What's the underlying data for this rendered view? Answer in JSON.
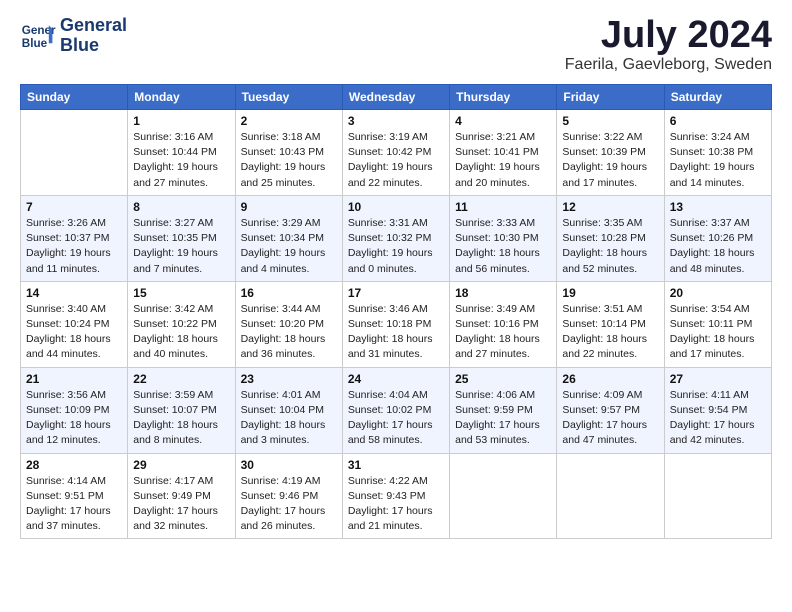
{
  "header": {
    "logo_line1": "General",
    "logo_line2": "Blue",
    "month": "July 2024",
    "location": "Faerila, Gaevleborg, Sweden"
  },
  "weekdays": [
    "Sunday",
    "Monday",
    "Tuesday",
    "Wednesday",
    "Thursday",
    "Friday",
    "Saturday"
  ],
  "weeks": [
    [
      {
        "day": "",
        "info": ""
      },
      {
        "day": "1",
        "info": "Sunrise: 3:16 AM\nSunset: 10:44 PM\nDaylight: 19 hours\nand 27 minutes."
      },
      {
        "day": "2",
        "info": "Sunrise: 3:18 AM\nSunset: 10:43 PM\nDaylight: 19 hours\nand 25 minutes."
      },
      {
        "day": "3",
        "info": "Sunrise: 3:19 AM\nSunset: 10:42 PM\nDaylight: 19 hours\nand 22 minutes."
      },
      {
        "day": "4",
        "info": "Sunrise: 3:21 AM\nSunset: 10:41 PM\nDaylight: 19 hours\nand 20 minutes."
      },
      {
        "day": "5",
        "info": "Sunrise: 3:22 AM\nSunset: 10:39 PM\nDaylight: 19 hours\nand 17 minutes."
      },
      {
        "day": "6",
        "info": "Sunrise: 3:24 AM\nSunset: 10:38 PM\nDaylight: 19 hours\nand 14 minutes."
      }
    ],
    [
      {
        "day": "7",
        "info": "Sunrise: 3:26 AM\nSunset: 10:37 PM\nDaylight: 19 hours\nand 11 minutes."
      },
      {
        "day": "8",
        "info": "Sunrise: 3:27 AM\nSunset: 10:35 PM\nDaylight: 19 hours\nand 7 minutes."
      },
      {
        "day": "9",
        "info": "Sunrise: 3:29 AM\nSunset: 10:34 PM\nDaylight: 19 hours\nand 4 minutes."
      },
      {
        "day": "10",
        "info": "Sunrise: 3:31 AM\nSunset: 10:32 PM\nDaylight: 19 hours\nand 0 minutes."
      },
      {
        "day": "11",
        "info": "Sunrise: 3:33 AM\nSunset: 10:30 PM\nDaylight: 18 hours\nand 56 minutes."
      },
      {
        "day": "12",
        "info": "Sunrise: 3:35 AM\nSunset: 10:28 PM\nDaylight: 18 hours\nand 52 minutes."
      },
      {
        "day": "13",
        "info": "Sunrise: 3:37 AM\nSunset: 10:26 PM\nDaylight: 18 hours\nand 48 minutes."
      }
    ],
    [
      {
        "day": "14",
        "info": "Sunrise: 3:40 AM\nSunset: 10:24 PM\nDaylight: 18 hours\nand 44 minutes."
      },
      {
        "day": "15",
        "info": "Sunrise: 3:42 AM\nSunset: 10:22 PM\nDaylight: 18 hours\nand 40 minutes."
      },
      {
        "day": "16",
        "info": "Sunrise: 3:44 AM\nSunset: 10:20 PM\nDaylight: 18 hours\nand 36 minutes."
      },
      {
        "day": "17",
        "info": "Sunrise: 3:46 AM\nSunset: 10:18 PM\nDaylight: 18 hours\nand 31 minutes."
      },
      {
        "day": "18",
        "info": "Sunrise: 3:49 AM\nSunset: 10:16 PM\nDaylight: 18 hours\nand 27 minutes."
      },
      {
        "day": "19",
        "info": "Sunrise: 3:51 AM\nSunset: 10:14 PM\nDaylight: 18 hours\nand 22 minutes."
      },
      {
        "day": "20",
        "info": "Sunrise: 3:54 AM\nSunset: 10:11 PM\nDaylight: 18 hours\nand 17 minutes."
      }
    ],
    [
      {
        "day": "21",
        "info": "Sunrise: 3:56 AM\nSunset: 10:09 PM\nDaylight: 18 hours\nand 12 minutes."
      },
      {
        "day": "22",
        "info": "Sunrise: 3:59 AM\nSunset: 10:07 PM\nDaylight: 18 hours\nand 8 minutes."
      },
      {
        "day": "23",
        "info": "Sunrise: 4:01 AM\nSunset: 10:04 PM\nDaylight: 18 hours\nand 3 minutes."
      },
      {
        "day": "24",
        "info": "Sunrise: 4:04 AM\nSunset: 10:02 PM\nDaylight: 17 hours\nand 58 minutes."
      },
      {
        "day": "25",
        "info": "Sunrise: 4:06 AM\nSunset: 9:59 PM\nDaylight: 17 hours\nand 53 minutes."
      },
      {
        "day": "26",
        "info": "Sunrise: 4:09 AM\nSunset: 9:57 PM\nDaylight: 17 hours\nand 47 minutes."
      },
      {
        "day": "27",
        "info": "Sunrise: 4:11 AM\nSunset: 9:54 PM\nDaylight: 17 hours\nand 42 minutes."
      }
    ],
    [
      {
        "day": "28",
        "info": "Sunrise: 4:14 AM\nSunset: 9:51 PM\nDaylight: 17 hours\nand 37 minutes."
      },
      {
        "day": "29",
        "info": "Sunrise: 4:17 AM\nSunset: 9:49 PM\nDaylight: 17 hours\nand 32 minutes."
      },
      {
        "day": "30",
        "info": "Sunrise: 4:19 AM\nSunset: 9:46 PM\nDaylight: 17 hours\nand 26 minutes."
      },
      {
        "day": "31",
        "info": "Sunrise: 4:22 AM\nSunset: 9:43 PM\nDaylight: 17 hours\nand 21 minutes."
      },
      {
        "day": "",
        "info": ""
      },
      {
        "day": "",
        "info": ""
      },
      {
        "day": "",
        "info": ""
      }
    ]
  ]
}
